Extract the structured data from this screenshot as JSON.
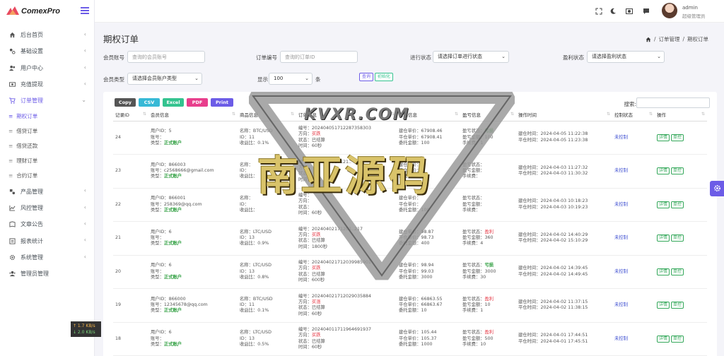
{
  "brand": {
    "name": "ComexPro"
  },
  "user": {
    "name": "admin",
    "role": "超级管理员"
  },
  "sidebar": {
    "items": [
      {
        "label": "后台首页",
        "icon": "home-icon"
      },
      {
        "label": "基础设置",
        "icon": "settings-icon"
      },
      {
        "label": "用户中心",
        "icon": "users-icon"
      },
      {
        "label": "充值提现",
        "icon": "money-icon"
      },
      {
        "label": "订单管理",
        "icon": "cart-icon"
      },
      {
        "label": "产品管理",
        "icon": "product-icon"
      },
      {
        "label": "风控管理",
        "icon": "chart-icon"
      },
      {
        "label": "文章公告",
        "icon": "article-icon"
      },
      {
        "label": "报表统计",
        "icon": "report-icon"
      },
      {
        "label": "系统管理",
        "icon": "gear-icon"
      },
      {
        "label": "管理员管理",
        "icon": "admin-icon"
      }
    ],
    "sub_items": [
      "期权订单",
      "借贷订单",
      "借贷还款",
      "理财订单",
      "合约订单"
    ]
  },
  "netspeed": {
    "up": "↑ 1.7 KB/s",
    "down": "↓ 2.0 KB/s"
  },
  "page": {
    "title": "期权订单",
    "breadcrumb": [
      "订单管理",
      "期权订单"
    ],
    "breadcrumb_sep": "/"
  },
  "filters": {
    "member_account": {
      "label": "会员账号",
      "placeholder": "查询的会员账号"
    },
    "order_no": {
      "label": "订单编号",
      "placeholder": "查询的订单ID"
    },
    "status": {
      "label": "进行状态",
      "value": "请选择订单进行状态"
    },
    "profit_status": {
      "label": "盈利状态",
      "value": "请选择盈利状态"
    },
    "member_type": {
      "label": "会员类型",
      "value": "请选择会员账户类型"
    },
    "display": {
      "label": "显示",
      "value": "100",
      "suffix": "条"
    },
    "query_btn": "查询",
    "reset_btn": "初始化"
  },
  "export_buttons": [
    {
      "label": "Copy",
      "color": "#555555"
    },
    {
      "label": "CSV",
      "color": "#37b9d6"
    },
    {
      "label": "Excel",
      "color": "#34c38f"
    },
    {
      "label": "PDF",
      "color": "#e83e8c"
    },
    {
      "label": "Print",
      "color": "#6c5ce7"
    }
  ],
  "table_search_label": "搜索:",
  "watermark": {
    "title": "KVXR.COM",
    "text": "南亚源码"
  },
  "columns": [
    "记录ID",
    "会员信息",
    "商品信息",
    "订单信息",
    "价格信息",
    "盈亏信息",
    "操作时间",
    "控制状态",
    "操作"
  ],
  "rows": [
    {
      "id": "24",
      "member": [
        "用户ID：5",
        "账号：",
        "类型："
      ],
      "member_type": "正式账户",
      "product": [
        "名称：BTC/USD",
        "ID：11",
        "收益比：0.1%"
      ],
      "order": [
        "编号：20240405171228735830​3",
        "方向：",
        "状态：已结算",
        "时间：60秒"
      ],
      "direction": "买跌",
      "direction_class": "c-red",
      "price": [
        "建仓单价：67908.46",
        "平仓单价：67908.41",
        "委托金额：100"
      ],
      "pnl": [
        "盈亏状态：",
        "盈亏金额：100",
        "手续费：1"
      ],
      "pnl_status": "亏损",
      "pnl_class": "c-green",
      "time": [
        "建仓时间：2024-04-05 11:22:38",
        "平仓时间：2024-04-05 11:23:38"
      ],
      "control": "未控制"
    },
    {
      "id": "23",
      "member": [
        "用户ID：866003",
        "账号：c2568666@gmail.com",
        "类型："
      ],
      "member_type": "正式账户",
      "product": [
        "名称：",
        "ID：",
        "收益比："
      ],
      "order": [
        "编号：2024040317121..",
        "方向：",
        "状态：",
        "时间：60秒"
      ],
      "direction": "",
      "direction_class": "c-red",
      "price": [
        "建仓单价：",
        "平仓单价：",
        "委托金额：10"
      ],
      "pnl": [
        "盈亏状态：",
        "盈亏金额：",
        "手续费："
      ],
      "pnl_status": "",
      "pnl_class": "c-green",
      "time": [
        "建仓时间：2024-04-03 11:27:32",
        "平仓时间：2024-04-03 11:30:32"
      ],
      "control": "未控制"
    },
    {
      "id": "22",
      "member": [
        "用户ID：866001",
        "账号：258369@qq.com",
        "类型："
      ],
      "member_type": "正式账户",
      "product": [
        "名称：",
        "ID：",
        "收益比："
      ],
      "order": [
        "编号：",
        "方向：",
        "状态：",
        "时间：60秒"
      ],
      "direction": "",
      "direction_class": "c-red",
      "price": [
        "建仓单价：",
        "平仓单价：",
        "委托金额：100"
      ],
      "pnl": [
        "盈亏状态：",
        "盈亏金额：",
        "手续费："
      ],
      "pnl_status": "",
      "pnl_class": "c-green",
      "time": [
        "建仓时间：2024-04-03 10:18:23",
        "平仓时间：2024-04-03 10:19:23"
      ],
      "control": "未控制"
    },
    {
      "id": "21",
      "member": [
        "用户ID：6",
        "账号：",
        "类型："
      ],
      "member_type": "正式账户",
      "product": [
        "名称：LTC/USD",
        "ID：13",
        "收益比：0.9%"
      ],
      "order": [
        "编号：20240402171201..217",
        "方向：",
        "状态：已结算",
        "时间：1800秒"
      ],
      "direction": "买跌",
      "direction_class": "c-red",
      "price": [
        "建仓单价：98.87",
        "平仓单价：98.73",
        "委托金额：400"
      ],
      "pnl": [
        "盈亏状态：",
        "盈亏金额：360",
        "手续费：4"
      ],
      "pnl_status": "盈利",
      "pnl_class": "c-red",
      "time": [
        "建仓时间：2024-04-02 14:40:29",
        "平仓时间：2024-04-02 15:10:29"
      ],
      "control": "未控制"
    },
    {
      "id": "20",
      "member": [
        "用户ID：6",
        "账号：",
        "类型："
      ],
      "member_type": "正式账户",
      "product": [
        "名称：LTC/USD",
        "ID：13",
        "收益比：0.8%"
      ],
      "order": [
        "编号：20240402171203998590​1",
        "方向：",
        "状态：已结算",
        "时间：600秒"
      ],
      "direction": "买跌",
      "direction_class": "c-red",
      "price": [
        "建仓单价：98.94",
        "平仓单价：99.03",
        "委托金额：3000"
      ],
      "pnl": [
        "盈亏状态：",
        "盈亏金额：3000",
        "手续费：30"
      ],
      "pnl_status": "亏损",
      "pnl_class": "c-green",
      "time": [
        "建仓时间：2024-04-02 14:39:45",
        "平仓时间：2024-04-02 14:49:45"
      ],
      "control": "未控制"
    },
    {
      "id": "19",
      "member": [
        "用户ID：866000",
        "账号：12345678@qq.com",
        "类型："
      ],
      "member_type": "正式账户",
      "product": [
        "名称：BTC/USD",
        "ID：11",
        "收益比：0.1%"
      ],
      "order": [
        "编号：20240402171202903588​4",
        "方向：",
        "状态：已结算",
        "时间：60秒"
      ],
      "direction": "买涨",
      "direction_class": "c-red",
      "price": [
        "建仓单价：66863.55",
        "平仓单价：66863.67",
        "委托金额：10"
      ],
      "pnl": [
        "盈亏状态：",
        "盈亏金额：10",
        "手续费：1"
      ],
      "pnl_status": "盈利",
      "pnl_class": "c-red",
      "time": [
        "建仓时间：2024-04-02 11:37:15",
        "平仓时间：2024-04-02 11:38:15"
      ],
      "control": "未控制"
    },
    {
      "id": "18",
      "member": [
        "用户ID：6",
        "账号：",
        "类型："
      ],
      "member_type": "正式账户",
      "product": [
        "名称：LTC/USD",
        "ID：13",
        "收益比：0.5%"
      ],
      "order": [
        "编号：20240401171196469193​7",
        "方向：",
        "状态：已结算",
        "时间：60秒"
      ],
      "direction": "买跌",
      "direction_class": "c-red",
      "price": [
        "建仓单价：105.44",
        "平仓单价：105.37",
        "委托金额：1000"
      ],
      "pnl": [
        "盈亏状态：",
        "盈亏金额：500",
        "手续费：10"
      ],
      "pnl_status": "盈利",
      "pnl_class": "c-red",
      "time": [
        "建仓时间：2024-04-01 17:44:51",
        "平仓时间：2024-04-01 17:45:51"
      ],
      "control": "未控制"
    }
  ],
  "row_actions": [
    "详情",
    "单控"
  ]
}
